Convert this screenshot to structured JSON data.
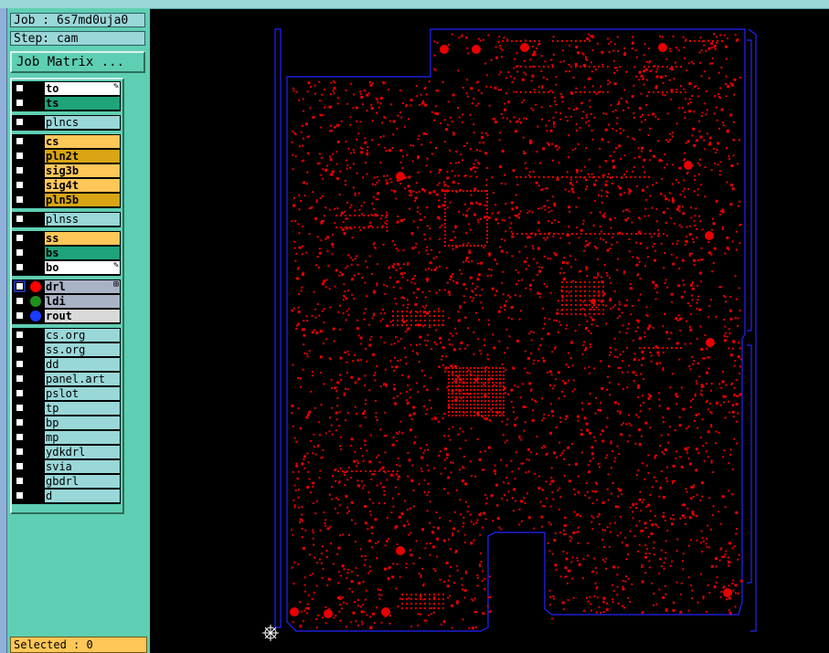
{
  "job": {
    "label": "Job : 6s7md0uja0"
  },
  "step": {
    "label": "Step: cam"
  },
  "job_matrix_button": "Job Matrix ...",
  "layers": [
    {
      "name": "to",
      "color": "#ffffff",
      "mark": "edit"
    },
    {
      "name": "ts",
      "color": "#1fa37b"
    },
    {
      "name": "plncs",
      "color": "#9ad7d9"
    },
    {
      "name": "cs",
      "color": "#ffc758"
    },
    {
      "name": "pln2t",
      "color": "#d9a514"
    },
    {
      "name": "sig3b",
      "color": "#ffc758"
    },
    {
      "name": "sig4t",
      "color": "#ffc758"
    },
    {
      "name": "pln5b",
      "color": "#d9a514"
    },
    {
      "name": "plnss",
      "color": "#9ad7d9"
    },
    {
      "name": "ss",
      "color": "#ffc758"
    },
    {
      "name": "bs",
      "color": "#1fa37b"
    },
    {
      "name": "bo",
      "color": "#ffffff",
      "mark": "edit"
    },
    {
      "name": "drl",
      "color": "#a9b3c6",
      "dot": "#ff0000",
      "active": true,
      "mark": "sym"
    },
    {
      "name": "ldi",
      "color": "#a9b3c6",
      "dot": "#1e8f1e"
    },
    {
      "name": "rout",
      "color": "#d9d9d9",
      "dot": "#1a3cff"
    },
    {
      "name": "cs.org",
      "color": "#9ad7d9"
    },
    {
      "name": "ss.org",
      "color": "#9ad7d9"
    },
    {
      "name": "dd",
      "color": "#9ad7d9"
    },
    {
      "name": "panel.art",
      "color": "#9ad7d9"
    },
    {
      "name": "pslot",
      "color": "#9ad7d9"
    },
    {
      "name": "tp",
      "color": "#9ad7d9"
    },
    {
      "name": "bp",
      "color": "#9ad7d9"
    },
    {
      "name": "mp",
      "color": "#9ad7d9"
    },
    {
      "name": "ydkdrl",
      "color": "#9ad7d9"
    },
    {
      "name": "svia",
      "color": "#9ad7d9"
    },
    {
      "name": "gbdrl",
      "color": "#9ad7d9"
    },
    {
      "name": "d",
      "color": "#9ad7d9"
    }
  ],
  "status": {
    "selected": "Selected : 0"
  },
  "board": {
    "outline_color": "#2323ff",
    "drill_color": "#e80000"
  }
}
